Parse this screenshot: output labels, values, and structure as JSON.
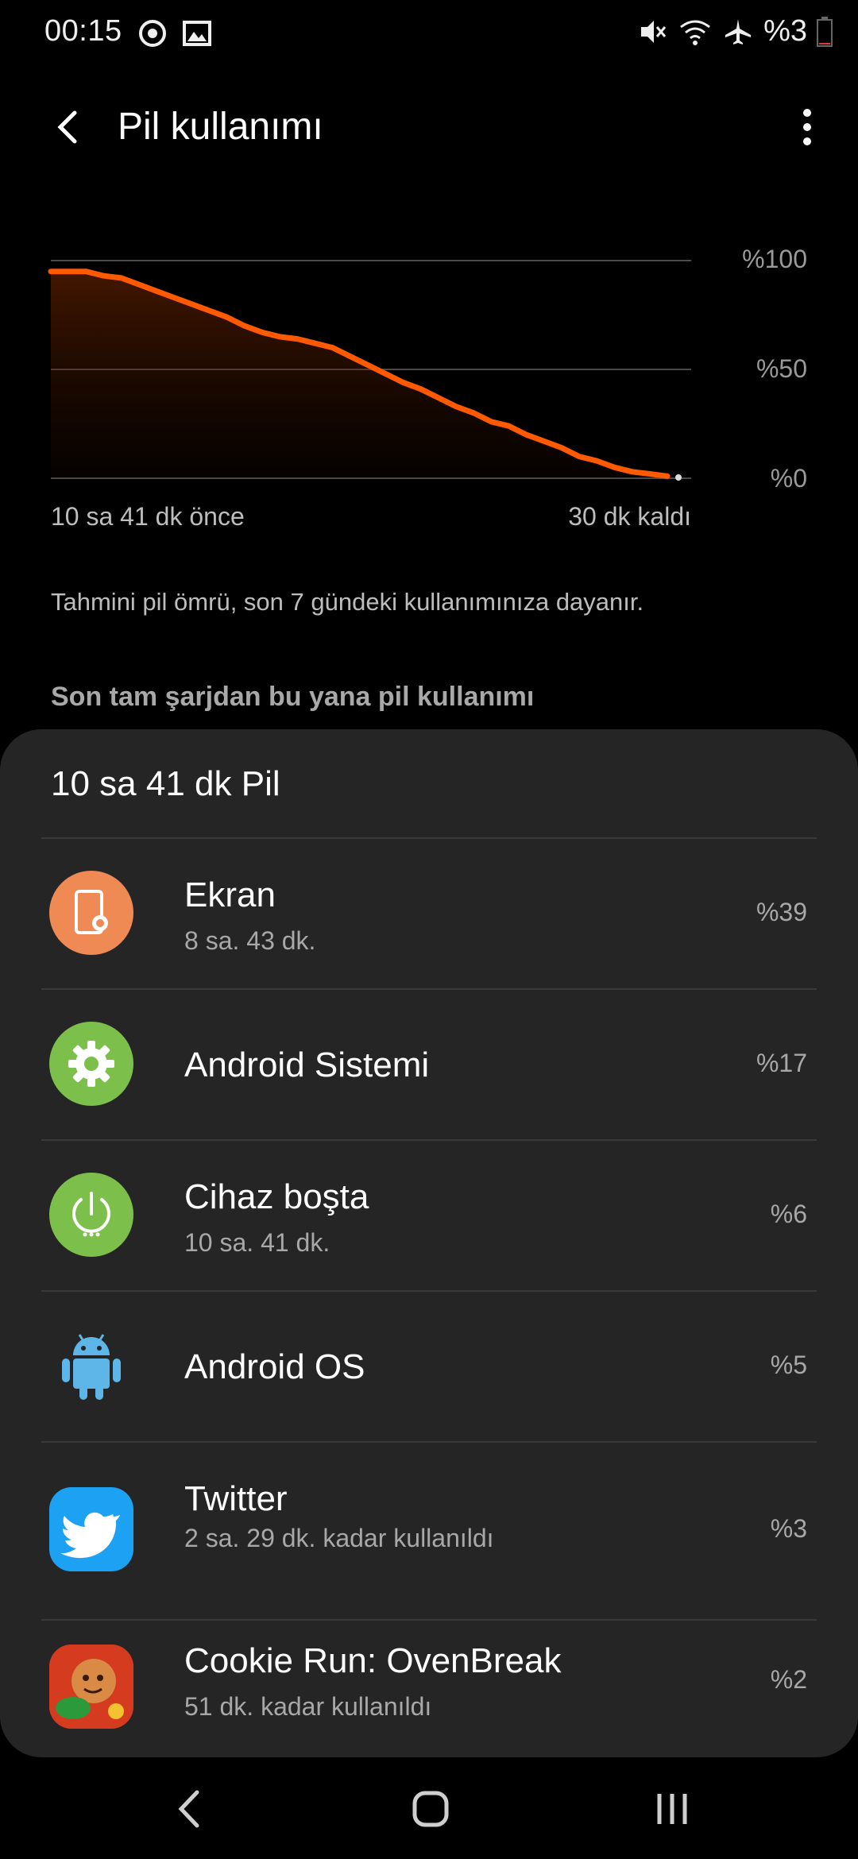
{
  "status_bar": {
    "time": "00:15",
    "left_icons": [
      "data-saver-icon",
      "image-icon"
    ],
    "right_icons": [
      "mute-icon",
      "wifi-icon",
      "airplane-icon",
      "battery-icon"
    ],
    "battery_text": "%3",
    "battery_level": 0.03
  },
  "header": {
    "title": "Pil kullanımı",
    "back_icon": "back-arrow-icon",
    "more_icon": "more-vert-icon"
  },
  "chart_data": {
    "type": "area",
    "x_start_label": "10 sa 41 dk önce",
    "x_end_label": "30 dk kaldı",
    "y_ticks": [
      "%100",
      "%50",
      "%0"
    ],
    "ylim": [
      0,
      100
    ],
    "grid": true,
    "color": "#ff5a00",
    "values": [
      95,
      95,
      95,
      93,
      92,
      89,
      86,
      83,
      80,
      77,
      74,
      70,
      67,
      65,
      64,
      62,
      60,
      56,
      52,
      48,
      44,
      41,
      37,
      33,
      30,
      26,
      24,
      20,
      17,
      14,
      10,
      8,
      5,
      3,
      2,
      1
    ]
  },
  "note": "Tahmini pil ömrü, son 7 gündeki kullanımınıza dayanır.",
  "section_title": "Son tam şarjdan bu yana pil kullanımı",
  "usage_card": {
    "title": "10 sa 41 dk Pil",
    "items": [
      {
        "name": "Ekran",
        "sub": "8 sa. 43 dk.",
        "percent": "%39",
        "icon": "screen-brightness-icon",
        "color": "#ef8a55"
      },
      {
        "name": "Android Sistemi",
        "sub": "",
        "percent": "%17",
        "icon": "gear-icon",
        "color": "#7cc04b"
      },
      {
        "name": "Cihaz boşta",
        "sub": "10 sa. 41 dk.",
        "percent": "%6",
        "icon": "power-icon",
        "color": "#7cc04b"
      },
      {
        "name": "Android OS",
        "sub": "",
        "percent": "%5",
        "icon": "android-robot-icon",
        "color": "#5db5e8"
      },
      {
        "name": "Twitter",
        "sub": "2 sa. 29 dk. kadar kullanıldı",
        "percent": "%3",
        "icon": "twitter-bird-icon",
        "color": "#1da1f2"
      },
      {
        "name": "Cookie Run: OvenBreak",
        "sub": "51 dk. kadar kullanıldı",
        "percent": "%2",
        "icon": "cookie-run-app-icon",
        "color": "#d43b1f"
      }
    ]
  },
  "nav_bar": {
    "icons": [
      "nav-back-icon",
      "nav-home-icon",
      "nav-recents-icon"
    ]
  }
}
